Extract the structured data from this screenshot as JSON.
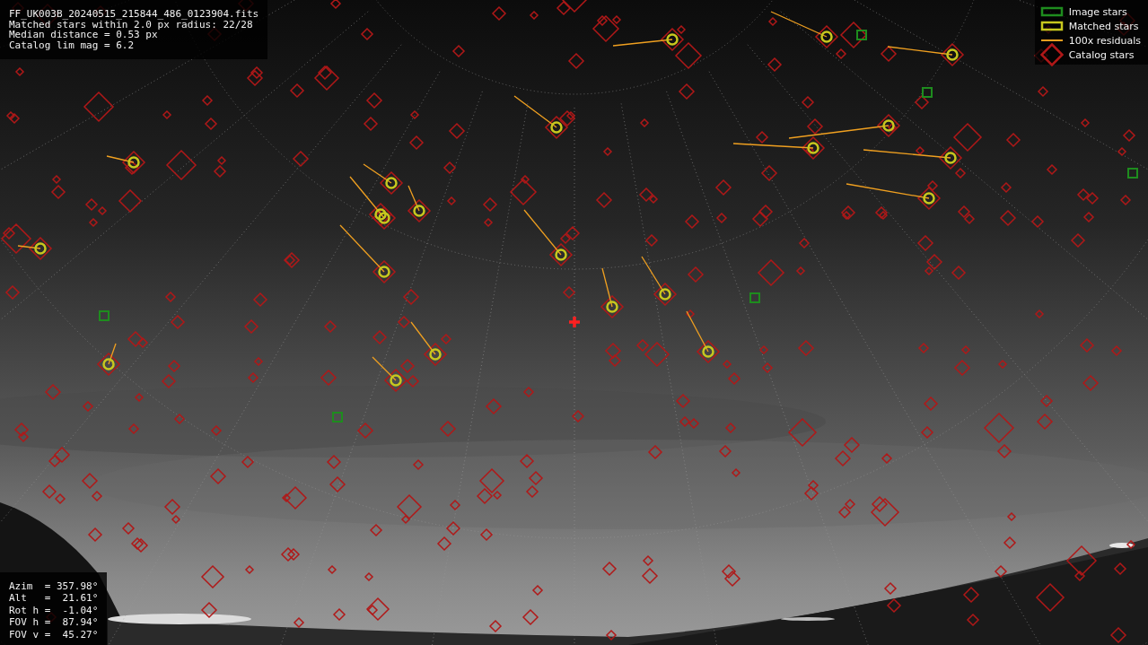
{
  "info_panel": {
    "lines": [
      "FF_UK003B_20240515_215844_486_0123904.fits",
      "Matched stars within 2.0 px radius: 22/28",
      "Median distance = 0.53 px",
      "Catalog lim mag = 6.2"
    ]
  },
  "legend": {
    "items": [
      {
        "kind": "box",
        "color": "#1e8c1e",
        "label": "Image stars"
      },
      {
        "kind": "box",
        "color": "#c8c81e",
        "label": "Matched stars"
      },
      {
        "kind": "line",
        "color": "#f0a020",
        "label": "100x residuals"
      },
      {
        "kind": "diamond",
        "color": "#b01818",
        "label": "Catalog stars"
      }
    ]
  },
  "pointing_panel": {
    "lines": [
      "Azim  = 357.98°",
      "Alt   =  21.61°",
      "Rot h =  -1.04°",
      "FOV h =  87.94°",
      "FOV v =  45.27°"
    ]
  }
}
